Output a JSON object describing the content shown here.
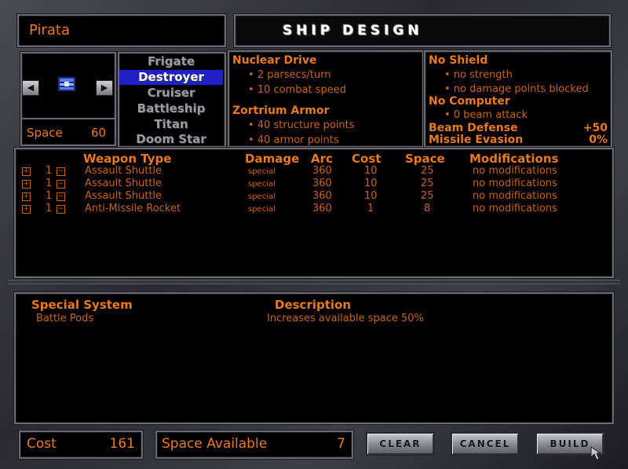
{
  "ship_name": "Pirata",
  "title": "SHIP DESIGN",
  "space_label": "Space",
  "space_value": "60",
  "ship_classes": [
    {
      "label": "Frigate",
      "selected": false
    },
    {
      "label": "Destroyer",
      "selected": true
    },
    {
      "label": "Cruiser",
      "selected": false
    },
    {
      "label": "Battleship",
      "selected": false
    },
    {
      "label": "Titan",
      "selected": false
    },
    {
      "label": "Doom Star",
      "selected": false
    }
  ],
  "drive": {
    "name": "Nuclear Drive",
    "line1": "2 parsecs/turn",
    "line2": "10 combat speed"
  },
  "armor": {
    "name": "Zortrium Armor",
    "line1": "40 structure points",
    "line2": "40 armor points"
  },
  "shield": {
    "name": "No Shield",
    "line1": "no strength",
    "line2": "no damage points blocked"
  },
  "computer": {
    "name": "No Computer",
    "line1": "0 beam attack"
  },
  "beam_defense": {
    "label": "Beam Defense",
    "value": "+50"
  },
  "missile_evasion": {
    "label": "Missile Evasion",
    "value": "0%"
  },
  "weapons_header": {
    "type": "Weapon Type",
    "damage": "Damage",
    "arc": "Arc",
    "cost": "Cost",
    "space": "Space",
    "mods": "Modifications"
  },
  "weapons": [
    {
      "qty": "1",
      "name": "Assault Shuttle",
      "damage": "special",
      "arc": "360",
      "cost": "10",
      "space": "25",
      "mods": "no modifications"
    },
    {
      "qty": "1",
      "name": "Assault Shuttle",
      "damage": "special",
      "arc": "360",
      "cost": "10",
      "space": "25",
      "mods": "no modifications"
    },
    {
      "qty": "1",
      "name": "Assault Shuttle",
      "damage": "special",
      "arc": "360",
      "cost": "10",
      "space": "25",
      "mods": "no modifications"
    },
    {
      "qty": "1",
      "name": "Anti-Missile Rocket",
      "damage": "special",
      "arc": "360",
      "cost": "1",
      "space": "8",
      "mods": "no modifications"
    }
  ],
  "specials_header": {
    "system": "Special System",
    "description": "Description"
  },
  "specials": [
    {
      "name": "Battle Pods",
      "description": "Increases available space 50%"
    }
  ],
  "footer": {
    "cost_label": "Cost",
    "cost_value": "161",
    "space_available_label": "Space Available",
    "space_available_value": "7",
    "clear": "CLEAR",
    "cancel": "CANCEL",
    "build": "BUILD"
  },
  "icons": {
    "ship": "ship-sprite-icon",
    "prev": "arrow-left-icon",
    "next": "arrow-right-icon"
  },
  "colors": {
    "accent": "#e87a22",
    "selected": "#2020c8"
  }
}
